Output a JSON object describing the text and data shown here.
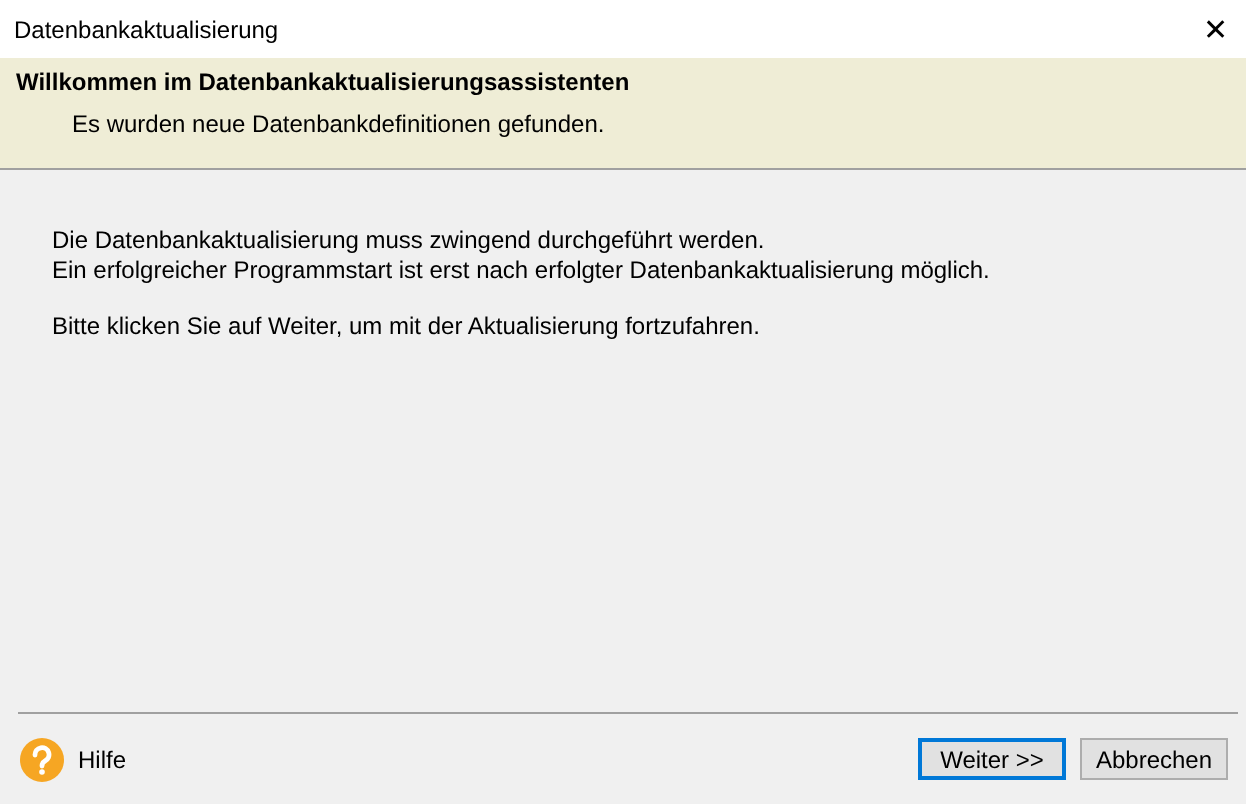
{
  "window": {
    "title": "Datenbankaktualisierung",
    "close": "✕"
  },
  "header": {
    "title": "Willkommen im Datenbankaktualisierungsassistenten",
    "subtitle": "Es wurden neue Datenbankdefinitionen gefunden."
  },
  "body": {
    "paragraphs": [
      [
        "Die Datenbankaktualisierung muss zwingend durchgeführt werden.",
        "Ein erfolgreicher Programmstart ist erst nach erfolgter Datenbankaktualisierung möglich."
      ],
      [
        "Bitte klicken Sie auf Weiter, um mit der Aktualisierung fortzufahren."
      ]
    ]
  },
  "footer": {
    "help": "Hilfe",
    "buttons": [
      {
        "label": "Weiter >>",
        "focused": true
      },
      {
        "label": "Abbrechen",
        "focused": false
      }
    ]
  }
}
